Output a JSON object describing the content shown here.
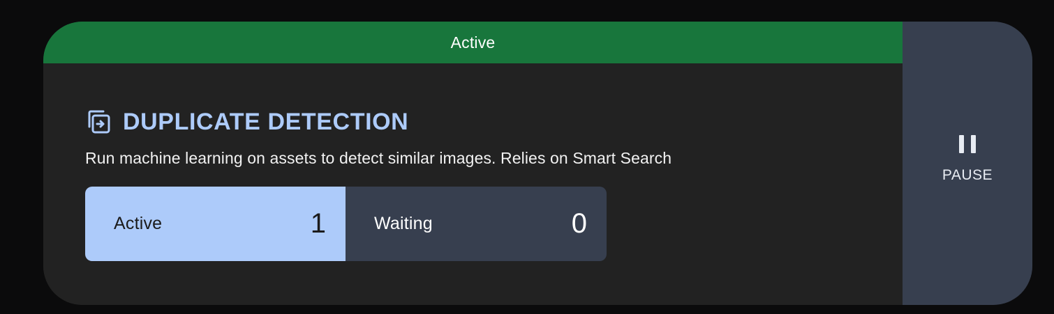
{
  "status": {
    "label": "Active",
    "color": "#18763c"
  },
  "job": {
    "icon": "duplicate-copy-icon",
    "title": "DUPLICATE DETECTION",
    "description": "Run machine learning on assets to detect similar images. Relies on Smart Search",
    "title_color": "#adcbfa"
  },
  "counters": [
    {
      "label": "Active",
      "value": "1",
      "color": "#adcbfa"
    },
    {
      "label": "Waiting",
      "value": "0",
      "color": "#373f4f"
    }
  ],
  "action": {
    "icon": "pause-icon",
    "label": "PAUSE"
  }
}
